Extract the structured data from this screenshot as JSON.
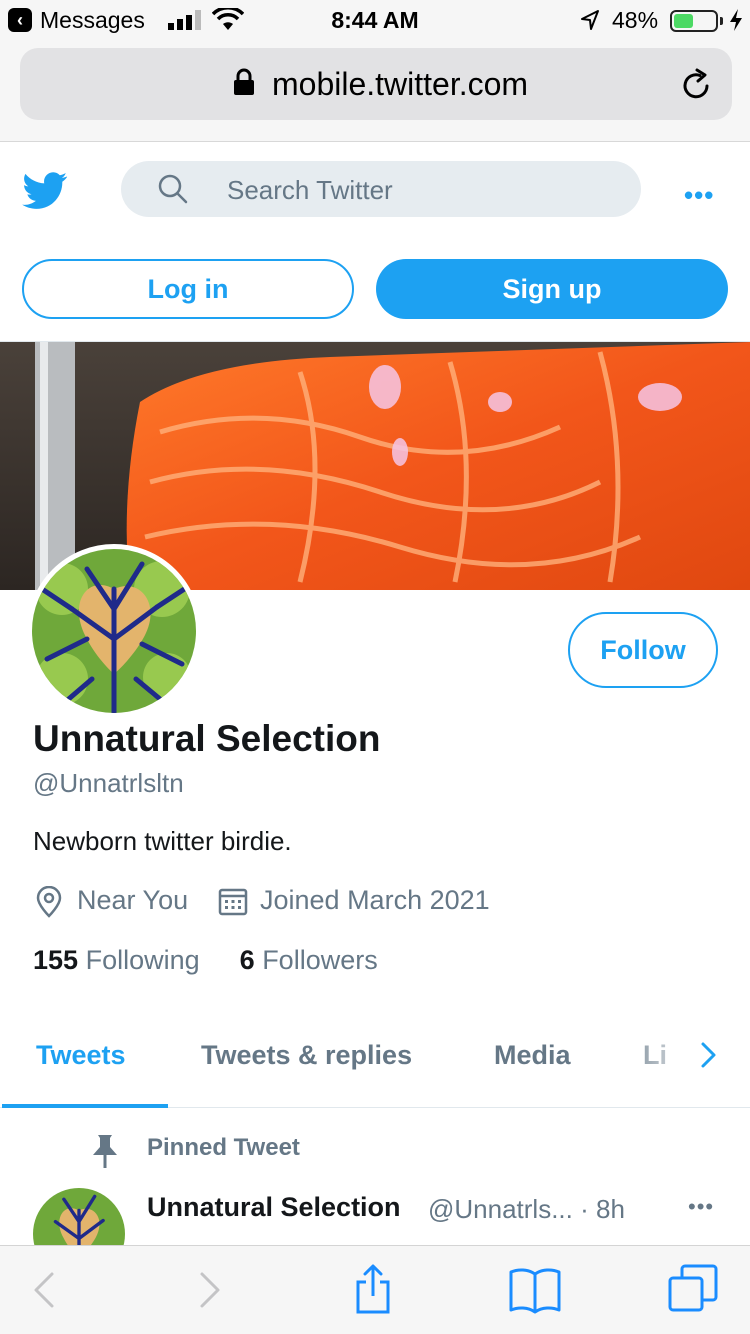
{
  "status_bar": {
    "back_app": "Messages",
    "time": "8:44 AM",
    "battery_pct": "48%",
    "battery_level": 0.48
  },
  "browser": {
    "url": "mobile.twitter.com"
  },
  "twitter_header": {
    "search_placeholder": "Search Twitter",
    "more_label": "•••",
    "login_label": "Log in",
    "signup_label": "Sign up"
  },
  "profile": {
    "follow_label": "Follow",
    "name": "Unnatural Selection",
    "handle": "@Unnatrlsltn",
    "bio": "Newborn twitter birdie.",
    "location": "Near You",
    "joined": "Joined March 2021",
    "following_count": "155",
    "following_label": "Following",
    "followers_count": "6",
    "followers_label": "Followers"
  },
  "tabs": [
    {
      "label": "Tweets",
      "active": true
    },
    {
      "label": "Tweets & replies",
      "active": false
    },
    {
      "label": "Media",
      "active": false
    },
    {
      "label": "Li",
      "active": false
    }
  ],
  "pinned_tweet": {
    "pinned_label": "Pinned Tweet",
    "author_name": "Unnatural Selection",
    "author_handle_time": "@Unnatrls... · 8h",
    "more_label": "•••"
  },
  "colors": {
    "twitter_blue": "#1da1f2",
    "secondary_text": "#657786",
    "primary_text": "#14171a"
  },
  "icons": [
    "back-icon",
    "signal-icon",
    "wifi-icon",
    "location-arrow-icon",
    "battery-icon",
    "charging-icon",
    "lock-icon",
    "reload-icon",
    "twitter-bird-icon",
    "search-icon",
    "more-icon",
    "location-pin-icon",
    "calendar-icon",
    "chevron-right-icon",
    "pin-icon",
    "nav-back-icon",
    "nav-forward-icon",
    "share-icon",
    "bookmarks-icon",
    "tabs-icon"
  ]
}
